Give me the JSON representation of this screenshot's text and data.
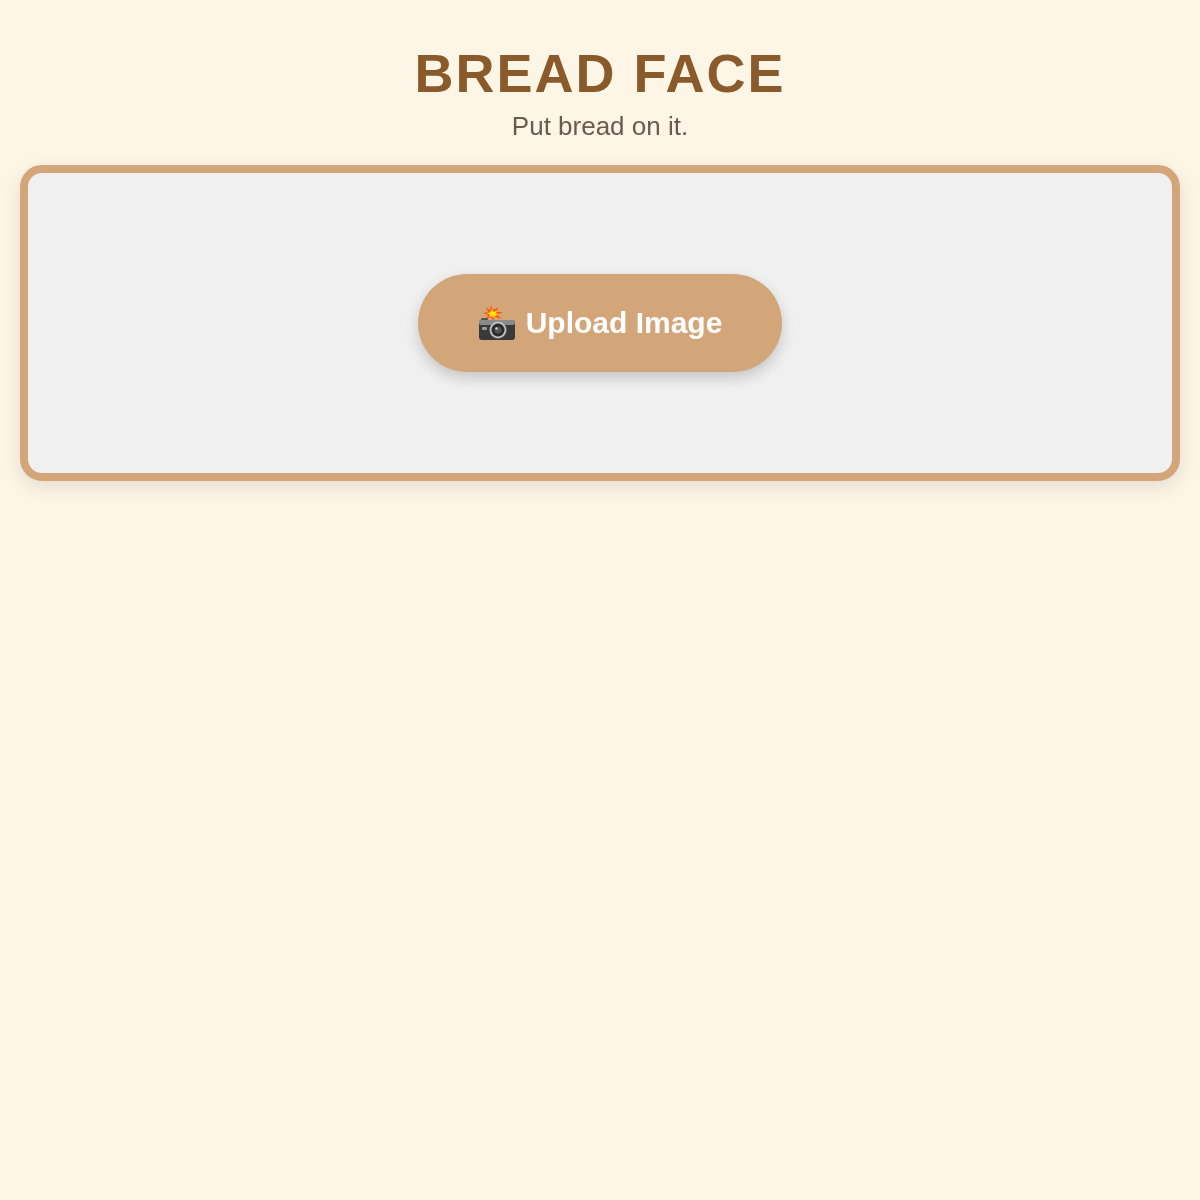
{
  "header": {
    "title": "BREAD FACE",
    "subtitle": "Put bread on it."
  },
  "upload_panel": {
    "button": {
      "label": "Upload Image"
    }
  }
}
